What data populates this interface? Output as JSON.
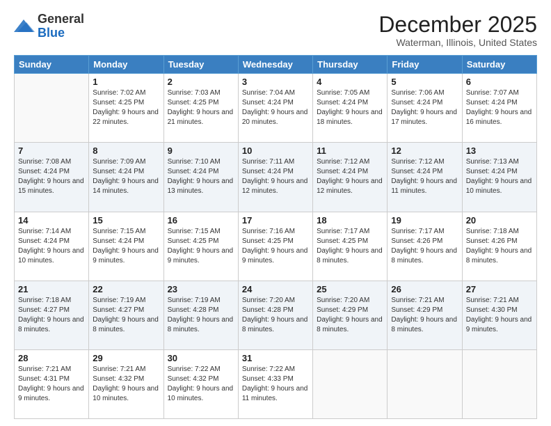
{
  "logo": {
    "general": "General",
    "blue": "Blue"
  },
  "header": {
    "month": "December 2025",
    "location": "Waterman, Illinois, United States"
  },
  "days_of_week": [
    "Sunday",
    "Monday",
    "Tuesday",
    "Wednesday",
    "Thursday",
    "Friday",
    "Saturday"
  ],
  "weeks": [
    [
      {
        "day": "",
        "sunrise": "",
        "sunset": "",
        "daylight": ""
      },
      {
        "day": "1",
        "sunrise": "Sunrise: 7:02 AM",
        "sunset": "Sunset: 4:25 PM",
        "daylight": "Daylight: 9 hours and 22 minutes."
      },
      {
        "day": "2",
        "sunrise": "Sunrise: 7:03 AM",
        "sunset": "Sunset: 4:25 PM",
        "daylight": "Daylight: 9 hours and 21 minutes."
      },
      {
        "day": "3",
        "sunrise": "Sunrise: 7:04 AM",
        "sunset": "Sunset: 4:24 PM",
        "daylight": "Daylight: 9 hours and 20 minutes."
      },
      {
        "day": "4",
        "sunrise": "Sunrise: 7:05 AM",
        "sunset": "Sunset: 4:24 PM",
        "daylight": "Daylight: 9 hours and 18 minutes."
      },
      {
        "day": "5",
        "sunrise": "Sunrise: 7:06 AM",
        "sunset": "Sunset: 4:24 PM",
        "daylight": "Daylight: 9 hours and 17 minutes."
      },
      {
        "day": "6",
        "sunrise": "Sunrise: 7:07 AM",
        "sunset": "Sunset: 4:24 PM",
        "daylight": "Daylight: 9 hours and 16 minutes."
      }
    ],
    [
      {
        "day": "7",
        "sunrise": "Sunrise: 7:08 AM",
        "sunset": "Sunset: 4:24 PM",
        "daylight": "Daylight: 9 hours and 15 minutes."
      },
      {
        "day": "8",
        "sunrise": "Sunrise: 7:09 AM",
        "sunset": "Sunset: 4:24 PM",
        "daylight": "Daylight: 9 hours and 14 minutes."
      },
      {
        "day": "9",
        "sunrise": "Sunrise: 7:10 AM",
        "sunset": "Sunset: 4:24 PM",
        "daylight": "Daylight: 9 hours and 13 minutes."
      },
      {
        "day": "10",
        "sunrise": "Sunrise: 7:11 AM",
        "sunset": "Sunset: 4:24 PM",
        "daylight": "Daylight: 9 hours and 12 minutes."
      },
      {
        "day": "11",
        "sunrise": "Sunrise: 7:12 AM",
        "sunset": "Sunset: 4:24 PM",
        "daylight": "Daylight: 9 hours and 12 minutes."
      },
      {
        "day": "12",
        "sunrise": "Sunrise: 7:12 AM",
        "sunset": "Sunset: 4:24 PM",
        "daylight": "Daylight: 9 hours and 11 minutes."
      },
      {
        "day": "13",
        "sunrise": "Sunrise: 7:13 AM",
        "sunset": "Sunset: 4:24 PM",
        "daylight": "Daylight: 9 hours and 10 minutes."
      }
    ],
    [
      {
        "day": "14",
        "sunrise": "Sunrise: 7:14 AM",
        "sunset": "Sunset: 4:24 PM",
        "daylight": "Daylight: 9 hours and 10 minutes."
      },
      {
        "day": "15",
        "sunrise": "Sunrise: 7:15 AM",
        "sunset": "Sunset: 4:24 PM",
        "daylight": "Daylight: 9 hours and 9 minutes."
      },
      {
        "day": "16",
        "sunrise": "Sunrise: 7:15 AM",
        "sunset": "Sunset: 4:25 PM",
        "daylight": "Daylight: 9 hours and 9 minutes."
      },
      {
        "day": "17",
        "sunrise": "Sunrise: 7:16 AM",
        "sunset": "Sunset: 4:25 PM",
        "daylight": "Daylight: 9 hours and 9 minutes."
      },
      {
        "day": "18",
        "sunrise": "Sunrise: 7:17 AM",
        "sunset": "Sunset: 4:25 PM",
        "daylight": "Daylight: 9 hours and 8 minutes."
      },
      {
        "day": "19",
        "sunrise": "Sunrise: 7:17 AM",
        "sunset": "Sunset: 4:26 PM",
        "daylight": "Daylight: 9 hours and 8 minutes."
      },
      {
        "day": "20",
        "sunrise": "Sunrise: 7:18 AM",
        "sunset": "Sunset: 4:26 PM",
        "daylight": "Daylight: 9 hours and 8 minutes."
      }
    ],
    [
      {
        "day": "21",
        "sunrise": "Sunrise: 7:18 AM",
        "sunset": "Sunset: 4:27 PM",
        "daylight": "Daylight: 9 hours and 8 minutes."
      },
      {
        "day": "22",
        "sunrise": "Sunrise: 7:19 AM",
        "sunset": "Sunset: 4:27 PM",
        "daylight": "Daylight: 9 hours and 8 minutes."
      },
      {
        "day": "23",
        "sunrise": "Sunrise: 7:19 AM",
        "sunset": "Sunset: 4:28 PM",
        "daylight": "Daylight: 9 hours and 8 minutes."
      },
      {
        "day": "24",
        "sunrise": "Sunrise: 7:20 AM",
        "sunset": "Sunset: 4:28 PM",
        "daylight": "Daylight: 9 hours and 8 minutes."
      },
      {
        "day": "25",
        "sunrise": "Sunrise: 7:20 AM",
        "sunset": "Sunset: 4:29 PM",
        "daylight": "Daylight: 9 hours and 8 minutes."
      },
      {
        "day": "26",
        "sunrise": "Sunrise: 7:21 AM",
        "sunset": "Sunset: 4:29 PM",
        "daylight": "Daylight: 9 hours and 8 minutes."
      },
      {
        "day": "27",
        "sunrise": "Sunrise: 7:21 AM",
        "sunset": "Sunset: 4:30 PM",
        "daylight": "Daylight: 9 hours and 9 minutes."
      }
    ],
    [
      {
        "day": "28",
        "sunrise": "Sunrise: 7:21 AM",
        "sunset": "Sunset: 4:31 PM",
        "daylight": "Daylight: 9 hours and 9 minutes."
      },
      {
        "day": "29",
        "sunrise": "Sunrise: 7:21 AM",
        "sunset": "Sunset: 4:32 PM",
        "daylight": "Daylight: 9 hours and 10 minutes."
      },
      {
        "day": "30",
        "sunrise": "Sunrise: 7:22 AM",
        "sunset": "Sunset: 4:32 PM",
        "daylight": "Daylight: 9 hours and 10 minutes."
      },
      {
        "day": "31",
        "sunrise": "Sunrise: 7:22 AM",
        "sunset": "Sunset: 4:33 PM",
        "daylight": "Daylight: 9 hours and 11 minutes."
      },
      {
        "day": "",
        "sunrise": "",
        "sunset": "",
        "daylight": ""
      },
      {
        "day": "",
        "sunrise": "",
        "sunset": "",
        "daylight": ""
      },
      {
        "day": "",
        "sunrise": "",
        "sunset": "",
        "daylight": ""
      }
    ]
  ]
}
